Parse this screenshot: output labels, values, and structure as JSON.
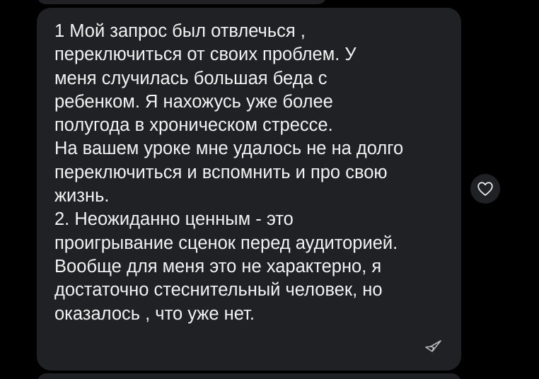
{
  "chat": {
    "message": {
      "text": "1  Мой запрос был  отвлечься ,\nпереключиться от своих проблем.  У\nменя случилась большая беда с\nребенком. Я нахожусь уже более\nполугода в хроническом стрессе.\nНа вашем уроке мне удалось не на долго\nпереключиться и вспомнить и про свою\nжизнь.\n2. Неожиданно ценным - это\nпроигрывание сценок перед аудиторией.\nВообще для меня это не характерно, я\nдостаточно стеснительный человек, но\nоказалось , что уже нет.",
      "reply_icon": "reply-arrow-icon"
    },
    "reaction": {
      "icon": "heart-icon"
    }
  },
  "colors": {
    "background": "#000000",
    "bubble": "#202125",
    "text": "#f2f2f2",
    "icon": "#b9bbbe"
  }
}
